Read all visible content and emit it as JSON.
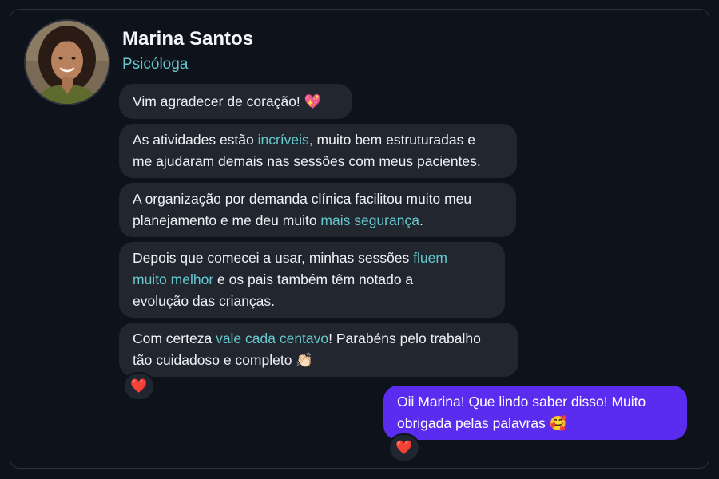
{
  "contact": {
    "name": "Marina Santos",
    "role": "Psicóloga",
    "avatar_icon": "avatar-photo"
  },
  "messages": [
    {
      "direction": "incoming",
      "lines": [
        [
          {
            "t": "Vim agradecer de coração! 💖"
          }
        ]
      ]
    },
    {
      "direction": "incoming",
      "lines": [
        [
          {
            "t": "As atividades estão "
          },
          {
            "t": "incríveis,",
            "hl": true
          },
          {
            "t": " muito bem estruturadas e"
          }
        ],
        [
          {
            "t": "me ajudaram demais nas sessões com meus pacientes."
          }
        ]
      ]
    },
    {
      "direction": "incoming",
      "lines": [
        [
          {
            "t": "A organização por demanda clínica facilitou muito meu"
          }
        ],
        [
          {
            "t": "planejamento e me deu muito "
          },
          {
            "t": "mais segurança",
            "hl": true
          },
          {
            "t": "."
          }
        ]
      ]
    },
    {
      "direction": "incoming",
      "lines": [
        [
          {
            "t": "Depois que comecei a usar, minhas sessões "
          },
          {
            "t": "fluem",
            "hl": true
          }
        ],
        [
          {
            "t": "muito melhor",
            "hl": true
          },
          {
            "t": " e os pais também têm notado a"
          }
        ],
        [
          {
            "t": "evolução das crianças."
          }
        ]
      ]
    },
    {
      "direction": "incoming",
      "lines": [
        [
          {
            "t": "Com certeza "
          },
          {
            "t": "vale cada centavo",
            "hl": true
          },
          {
            "t": "! Parabéns pelo trabalho"
          }
        ],
        [
          {
            "t": "tão cuidadoso e completo 👏🏻"
          }
        ]
      ],
      "reaction": "❤️"
    },
    {
      "direction": "outgoing",
      "lines": [
        [
          {
            "t": "Oii Marina! Que lindo saber disso! Muito"
          }
        ],
        [
          {
            "t": "obrigada pelas palavras 🥰"
          }
        ]
      ],
      "reaction": "❤️"
    }
  ],
  "colors": {
    "background": "#0d121b",
    "incoming_bubble": "#21262f",
    "outgoing_bubble": "#5a2cf0",
    "highlight": "#66c7ce",
    "reaction_heart": "#e2293b"
  }
}
